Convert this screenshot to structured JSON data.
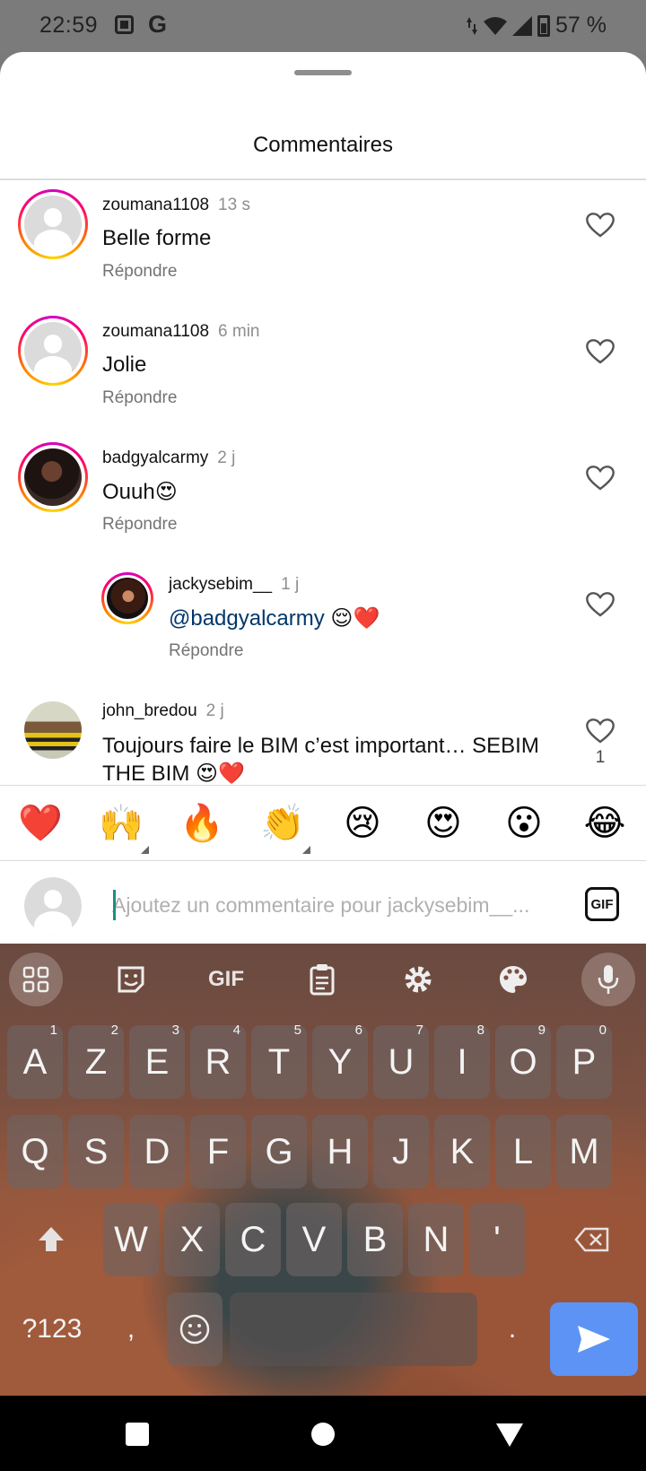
{
  "status_bar": {
    "time": "22:59",
    "g_label": "G",
    "battery": "57 %"
  },
  "sheet": {
    "title": "Commentaires"
  },
  "comments": [
    {
      "user": "zoumana1108",
      "time": "13 s",
      "text": "Belle forme",
      "reply": "Répondre"
    },
    {
      "user": "zoumana1108",
      "time": "6 min",
      "text": "Jolie",
      "reply": "Répondre"
    },
    {
      "user": "badgyalcarmy",
      "time": "2 j",
      "text": "Ouuh😍",
      "reply": "Répondre"
    },
    {
      "user": "jackysebim__",
      "time": "1 j",
      "mention": "@badgyalcarmy",
      "text": " 😌❤️",
      "reply": "Répondre"
    },
    {
      "user": "john_bredou",
      "time": "2 j",
      "text": "Toujours faire le BIM c’est important… SEBIM",
      "text_line2": "THE BIM 😍❤️",
      "likes": "1"
    }
  ],
  "emoji_bar": [
    "❤️",
    "🙌",
    "🔥",
    "👏",
    "😢",
    "😍",
    "😮",
    "😂"
  ],
  "input": {
    "placeholder": "Ajoutez un commentaire pour jackysebim__...",
    "gif_label": "GIF"
  },
  "keyboard": {
    "toolbar_gif": "GIF",
    "row1": [
      "A",
      "Z",
      "E",
      "R",
      "T",
      "Y",
      "U",
      "I",
      "O",
      "P"
    ],
    "row1_hints": [
      "1",
      "2",
      "3",
      "4",
      "5",
      "6",
      "7",
      "8",
      "9",
      "0"
    ],
    "row2": [
      "Q",
      "S",
      "D",
      "F",
      "G",
      "H",
      "J",
      "K",
      "L",
      "M"
    ],
    "row3": [
      "W",
      "X",
      "C",
      "V",
      "B",
      "N",
      "'"
    ],
    "symbols_key": "?123",
    "comma_key": ",",
    "period_key": "."
  }
}
